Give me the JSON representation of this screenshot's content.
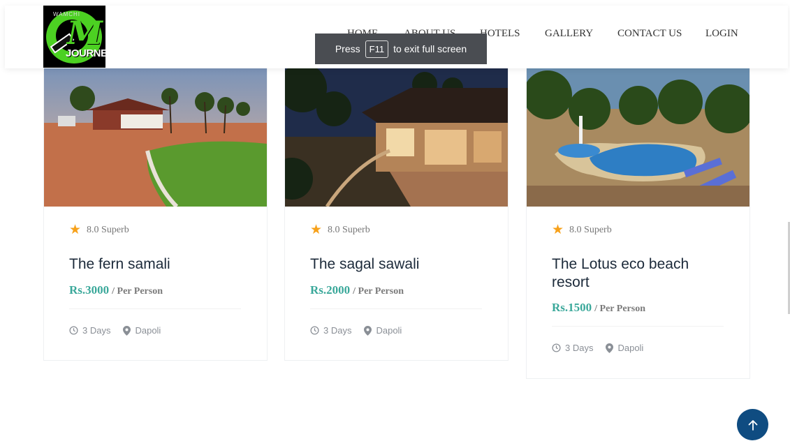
{
  "brand": {
    "logo_text": "JOURNEY",
    "logo_letter": "M",
    "logo_arc": "WAMCHI"
  },
  "nav": {
    "items": [
      "HOME",
      "ABOUT US",
      "HOTELS",
      "GALLERY",
      "CONTACT US",
      "LOGIN"
    ]
  },
  "toast": {
    "press": "Press",
    "key": "F11",
    "rest": "to exit full screen"
  },
  "cards": [
    {
      "rating": "8.0 Superb",
      "title": "The fern samali",
      "price": "Rs.3000",
      "per": "/ Per Person",
      "duration": "3 Days",
      "location": "Dapoli"
    },
    {
      "rating": "8.0 Superb",
      "title": "The sagal sawali",
      "price": "Rs.2000",
      "per": "/ Per Person",
      "duration": "3 Days",
      "location": "Dapoli"
    },
    {
      "rating": "8.0 Superb",
      "title": "The Lotus eco beach resort",
      "price": "Rs.1500",
      "per": "/ Per Person",
      "duration": "3 Days",
      "location": "Dapoli"
    }
  ],
  "colors": {
    "accent": "#3aa89a",
    "star": "#f7a11a",
    "scroll_button": "#0f4c81"
  },
  "icons": {
    "star": "star-icon",
    "clock": "clock-icon",
    "location": "map-pin-icon",
    "scroll_top": "arrow-up-icon"
  }
}
